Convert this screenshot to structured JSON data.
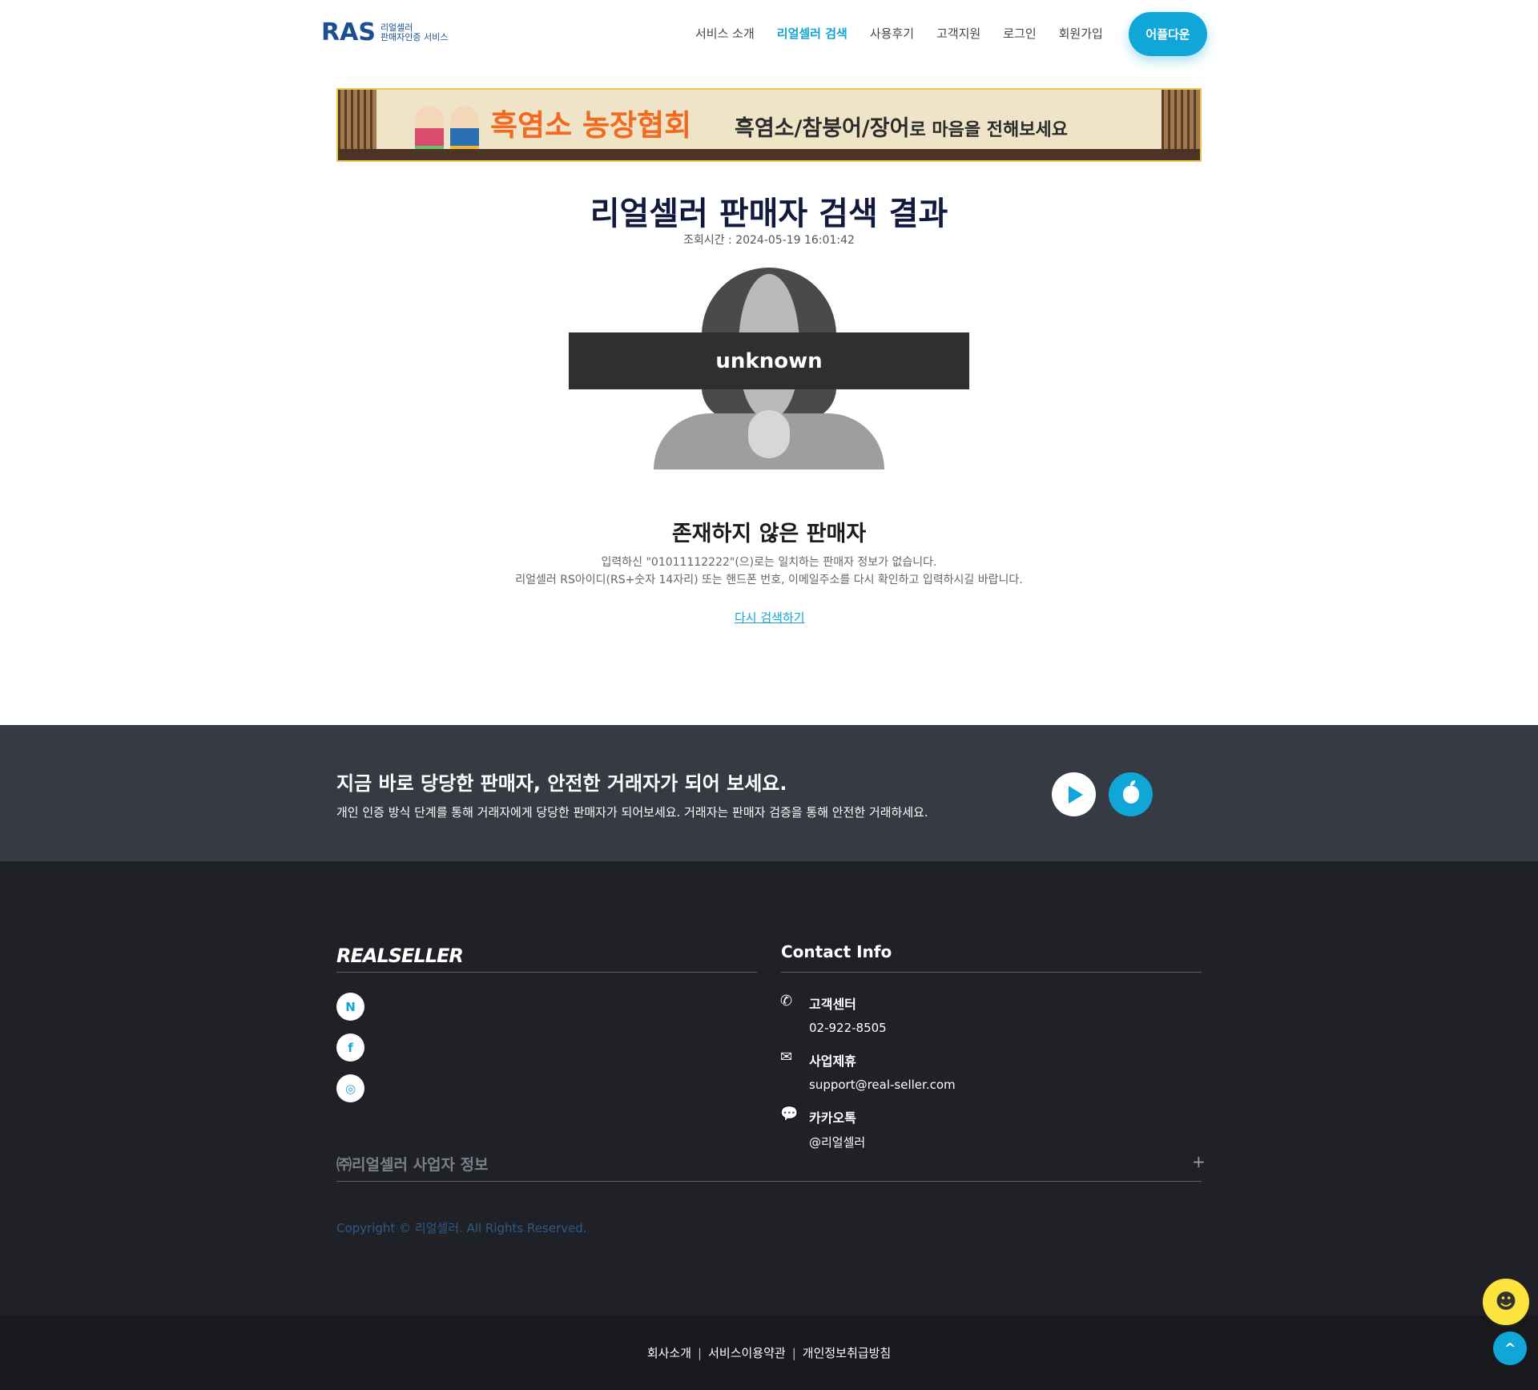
{
  "header": {
    "logo_mark": "RAS",
    "logo_line1": "리얼셀러",
    "logo_line2": "판매자인증 서비스",
    "nav": [
      "서비스 소개",
      "리얼셀러 검색",
      "사용후기",
      "고객지원",
      "로그인",
      "회원가입"
    ],
    "app_button": "어플다운"
  },
  "banner": {
    "title": "흑염소 농장협회",
    "subtitle_main": "흑염소/참붕어/장어",
    "subtitle_tail": "로 마음을 전해보세요"
  },
  "result": {
    "title": "리얼셀러 판매자 검색 결과",
    "time": "조회시간 : 2024-05-19 16:01:42",
    "unknown_label": "unknown",
    "message_title": "존재하지 않은 판매자",
    "message_line1": "입력하신 \"01011112222\"(으)로는 일치하는 판매자 정보가 없습니다.",
    "message_line2": "리얼셀러 RS아이디(RS+숫자 14자리) 또는 핸드폰 번호, 이메일주소를 다시 확인하고 입력하시길 바랍니다.",
    "retry_link": "다시 검색하기"
  },
  "cta": {
    "title": "지금 바로 당당한 판매자, 안전한 거래자가 되어 보세요.",
    "text": "개인 인증 방식 단계를 통해 거래자에게 당당한 판매자가 되어보세요. 거래자는 판매자 검증을 통해 안전한 거래하세요."
  },
  "footer": {
    "brand": "REALSELLER",
    "contact_title": "Contact Info",
    "social": [
      "N",
      "f",
      "◎"
    ],
    "contacts": [
      {
        "label": "고객센터",
        "value": "02-922-8505"
      },
      {
        "label": "사업제휴",
        "value": "support@real-seller.com"
      },
      {
        "label": "카카오톡",
        "value": "@리얼셀러"
      }
    ],
    "biz_info": "㈜리얼셀러 사업자 정보",
    "biz_toggle": "+",
    "copyright": "Copyright © 리얼셀러. All Rights Reserved.",
    "bottom_links": [
      "회사소개",
      "서비스이용약관",
      "개인정보취급방침"
    ]
  },
  "colors": {
    "accent": "#10a7d8",
    "navy": "#111a3c",
    "cta_bg": "#353a43",
    "footer_bg": "#1f2127"
  }
}
